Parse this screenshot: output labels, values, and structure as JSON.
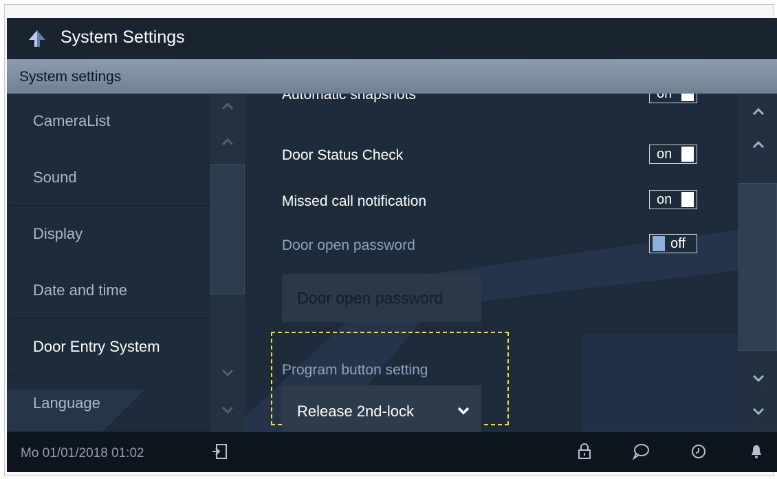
{
  "header": {
    "title": "System Settings"
  },
  "subheader": {
    "title": "System settings"
  },
  "sidebar": {
    "items": [
      {
        "label": "CameraList"
      },
      {
        "label": "Sound"
      },
      {
        "label": "Display"
      },
      {
        "label": "Date and time"
      },
      {
        "label": "Door Entry System",
        "active": true
      },
      {
        "label": "Language"
      }
    ]
  },
  "settings": {
    "rows": [
      {
        "label": "Automatic snapshots",
        "state": "on"
      },
      {
        "label": "Door Status Check",
        "state": "on"
      },
      {
        "label": "Missed call notification",
        "state": "on"
      },
      {
        "label": "Door open password",
        "state": "off"
      }
    ],
    "password_button": "Door open password",
    "program_label": "Program button setting",
    "program_value": "Release 2nd-lock"
  },
  "statusbar": {
    "datetime": "Mo 01/01/2018   01:02"
  },
  "icons": [
    "back-arrow-icon",
    "chevron-up-icon",
    "chevron-down-icon",
    "exit-icon",
    "lock-icon",
    "message-icon",
    "history-icon",
    "bell-icon"
  ],
  "colors": {
    "highlight": "#f2df2a",
    "accent": "#8bb0dc"
  }
}
